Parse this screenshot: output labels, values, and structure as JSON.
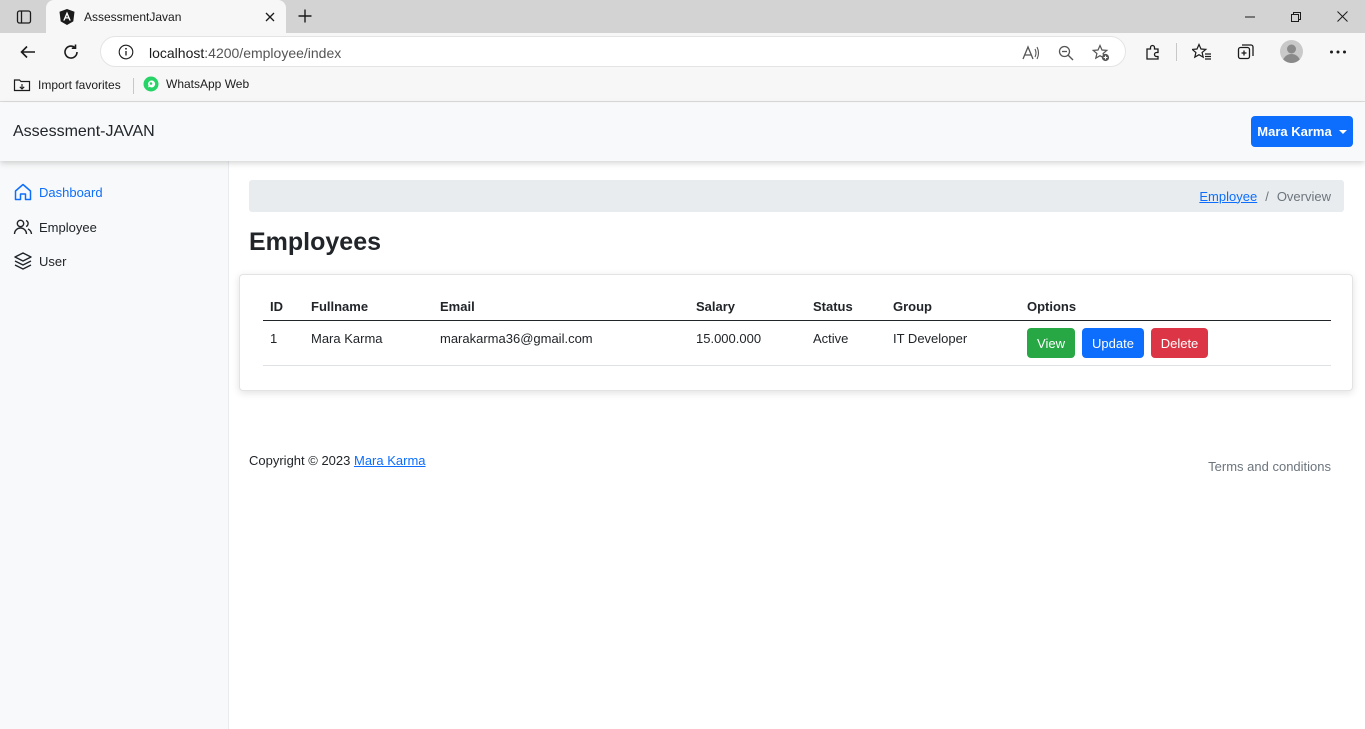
{
  "browser": {
    "tab_title": "AssessmentJavan",
    "url_host": "localhost",
    "url_path": ":4200/employee/index",
    "favorites": [
      {
        "label": "Import favorites"
      },
      {
        "label": "WhatsApp Web"
      }
    ]
  },
  "navbar": {
    "brand": "Assessment-JAVAN",
    "user_name": "Mara Karma"
  },
  "sidebar": {
    "items": [
      {
        "label": "Dashboard",
        "icon": "home-icon",
        "active": true
      },
      {
        "label": "Employee",
        "icon": "users-icon",
        "active": false
      },
      {
        "label": "User",
        "icon": "layers-icon",
        "active": false
      }
    ]
  },
  "breadcrumb": {
    "link": "Employee",
    "separator": "/",
    "current": "Overview"
  },
  "page": {
    "title": "Employees"
  },
  "table": {
    "headers": [
      "ID",
      "Fullname",
      "Email",
      "Salary",
      "Status",
      "Group",
      "Options"
    ],
    "rows": [
      {
        "id": "1",
        "fullname": "Mara Karma",
        "email": "marakarma36@gmail.com",
        "salary": "15.000.000",
        "status": "Active",
        "group": "IT Developer",
        "actions": {
          "view": "View",
          "update": "Update",
          "delete": "Delete"
        }
      }
    ]
  },
  "footer": {
    "copyright": "Copyright © 2023",
    "author_link": "Mara Karma",
    "terms": "Terms and conditions"
  },
  "colors": {
    "primary": "#0d6efd",
    "success": "#28a745",
    "danger": "#dc3545"
  }
}
